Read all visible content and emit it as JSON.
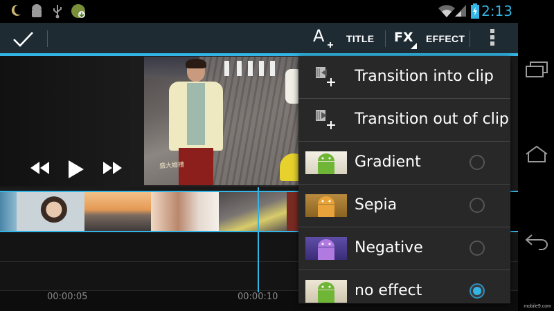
{
  "status_bar": {
    "time": "2:13",
    "icons": [
      "moon-icon",
      "android-debug-icon",
      "usb-icon",
      "app-update-icon",
      "wifi-icon",
      "signal-icon",
      "battery-charging-icon"
    ]
  },
  "action_bar": {
    "done_icon": "checkmark-icon",
    "title_label": "TITLE",
    "effect_label": "EFFECT",
    "title_icon_glyph": "A",
    "fx_icon_glyph": "FX",
    "accent_color": "#33b5e5"
  },
  "preview": {
    "watermark": "盛大婚禮"
  },
  "playback": {
    "rewind_icon": "rewind-icon",
    "play_icon": "play-icon",
    "fast_forward_icon": "fast-forward-icon"
  },
  "timeline": {
    "timecodes": [
      "00:00:05",
      "00:00:10"
    ]
  },
  "menu": {
    "items": [
      {
        "label": "Transition into clip",
        "icon": "transition-in-icon"
      },
      {
        "label": "Transition out of clip",
        "icon": "transition-out-icon"
      },
      {
        "label": "Gradient",
        "effect": "gradient",
        "selected": false
      },
      {
        "label": "Sepia",
        "effect": "sepia",
        "selected": false
      },
      {
        "label": "Negative",
        "effect": "negative",
        "selected": false
      },
      {
        "label": "no effect",
        "effect": "none",
        "selected": true
      }
    ]
  },
  "nav_bar": {
    "icons": [
      "recent-apps-icon",
      "home-icon",
      "back-icon"
    ]
  },
  "credit": "mobile9.com"
}
